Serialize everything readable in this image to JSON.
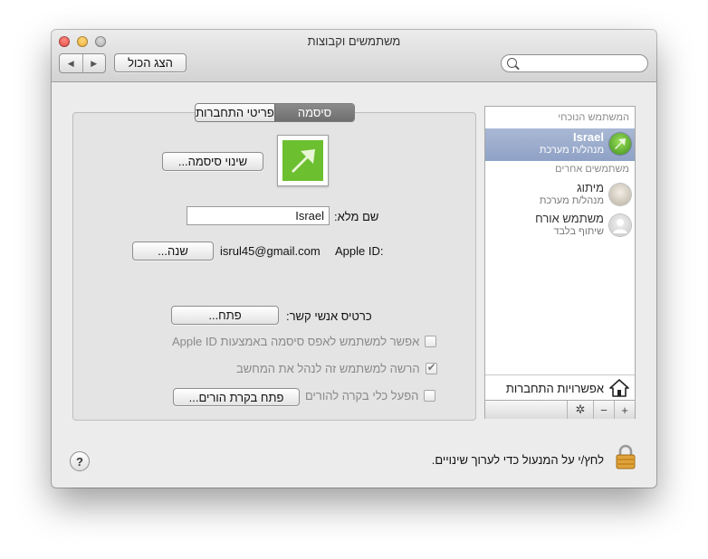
{
  "window": {
    "title": "משתמשים וקבוצות"
  },
  "toolbar": {
    "back_glyph": "◀",
    "forward_glyph": "▶",
    "show_all_label": "הצג הכול",
    "search_placeholder": ""
  },
  "sidebar": {
    "current_user_header": "המשתמש הנוכחי",
    "other_users_header": "משתמשים אחרים",
    "current_user": {
      "name": "Israel",
      "role": "מנהל/ת מערכת",
      "avatar_icon": "green-arrow-icon"
    },
    "other_users": [
      {
        "name": "מיתוג",
        "role": "מנהל/ת מערכת",
        "avatar_icon": "user-photo-icon"
      },
      {
        "name": "משתמש אורח",
        "role": "שיתוף בלבד",
        "avatar_icon": "guest-silhouette-icon"
      }
    ],
    "login_options_label": "אפשרויות התחברות",
    "add_glyph": "+",
    "remove_glyph": "−",
    "gear_glyph": "✲"
  },
  "main": {
    "tabs": [
      {
        "label": "סיסמה",
        "active": true
      },
      {
        "label": "פריטי התחברות",
        "active": false
      }
    ],
    "change_password_label": "שינוי סיסמה...",
    "full_name_label": "שם מלא:",
    "full_name_value": "Israel",
    "apple_id_label": "Apple ID:",
    "apple_id_value": "isrul45@gmail.com",
    "change_apple_id_label": "שנה...",
    "contact_card_label": "כרטיס אנשי קשר:",
    "open_label": "פתח...",
    "allow_reset_password_label": "אפשר למשתמש לאפס סיסמה באמצעות Apple ID",
    "allow_admin_label": "הרשה למשתמש זה לנהל את המחשב",
    "enable_parental_label": "הפעל כלי בקרה להורים",
    "open_parental_label": "פתח בקרת הורים..."
  },
  "footer": {
    "help_glyph": "?",
    "lock_text": "לחץ/י על המנעול כדי לערוך שינויים."
  },
  "colors": {
    "selection": "#8fa2c6",
    "tab_active": "#7a7a7a",
    "window_bg": "#ececec"
  }
}
